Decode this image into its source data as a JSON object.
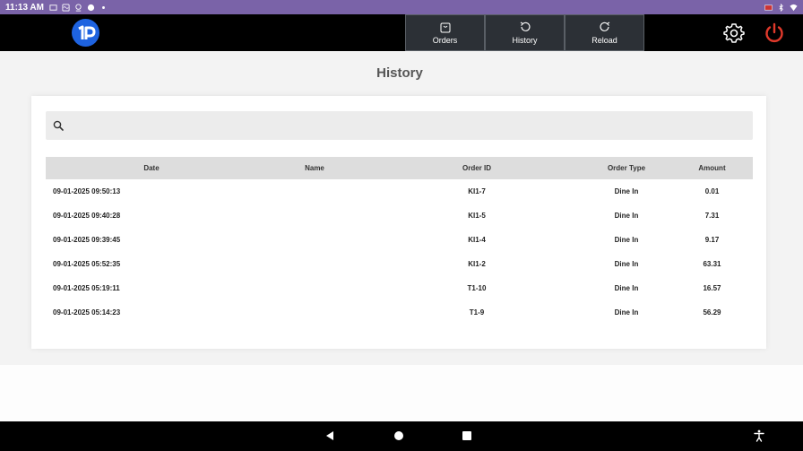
{
  "status_bar": {
    "time": "11:13 AM",
    "left_icons": [
      "cast-icon",
      "wave-icon",
      "location-icon",
      "vpn-icon",
      "dot-icon"
    ],
    "right_icons": [
      "flag-icon",
      "bluetooth-icon",
      "wifi-icon"
    ]
  },
  "header": {
    "logo_text": "1P",
    "nav": {
      "orders": "Orders",
      "history": "History",
      "reload": "Reload"
    },
    "colors": {
      "logo": "#1e63e0",
      "power": "#e0392b"
    }
  },
  "page": {
    "title": "History"
  },
  "search": {
    "value": "",
    "placeholder": ""
  },
  "table": {
    "columns": {
      "date": "Date",
      "name": "Name",
      "order_id": "Order ID",
      "order_type": "Order Type",
      "amount": "Amount"
    },
    "rows": [
      {
        "date": "09-01-2025 09:50:13",
        "name": "",
        "order_id": "KI1-7",
        "order_type": "Dine In",
        "amount": "0.01"
      },
      {
        "date": "09-01-2025 09:40:28",
        "name": "",
        "order_id": "KI1-5",
        "order_type": "Dine In",
        "amount": "7.31"
      },
      {
        "date": "09-01-2025 09:39:45",
        "name": "",
        "order_id": "KI1-4",
        "order_type": "Dine In",
        "amount": "9.17"
      },
      {
        "date": "09-01-2025 05:52:35",
        "name": "",
        "order_id": "KI1-2",
        "order_type": "Dine In",
        "amount": "63.31"
      },
      {
        "date": "09-01-2025 05:19:11",
        "name": "",
        "order_id": "T1-10",
        "order_type": "Dine In",
        "amount": "16.57"
      },
      {
        "date": "09-01-2025 05:14:23",
        "name": "",
        "order_id": "T1-9",
        "order_type": "Dine In",
        "amount": "56.29"
      }
    ]
  }
}
